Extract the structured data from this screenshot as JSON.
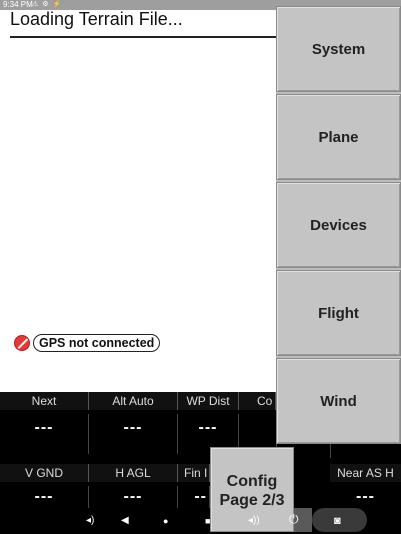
{
  "status_bar": {
    "time": "9:34 PM",
    "icons": "⚠ ⚙ ⚡"
  },
  "loading_text": "Loading Terrain File...",
  "gps_status": "GPS not connected",
  "menu": [
    {
      "label": "System"
    },
    {
      "label": "Plane"
    },
    {
      "label": "Devices"
    },
    {
      "label": "Flight"
    },
    {
      "label": "Wind"
    }
  ],
  "data_panel": {
    "row1": [
      {
        "label": "Next",
        "value": "---"
      },
      {
        "label": "Alt Auto",
        "value": "---"
      },
      {
        "label": "WP Dist",
        "value": "---"
      },
      {
        "label": "Co",
        "value": ""
      },
      {
        "label": "",
        "value": ""
      }
    ],
    "row2": [
      {
        "label": "V GND",
        "value": "---"
      },
      {
        "label": "H AGL",
        "value": "---"
      },
      {
        "label": "Fin I",
        "value": "--"
      },
      {
        "label": "",
        "value": ""
      },
      {
        "label": "Near AS H",
        "value": "---"
      }
    ]
  },
  "config": {
    "line1": "Config",
    "line2": "Page 2/3"
  },
  "nav_bar": {
    "icons": [
      "volume-down-icon",
      "back-icon",
      "home-icon",
      "recents-icon",
      "volume-up-icon",
      "power-icon",
      "screenshot-icon"
    ]
  }
}
